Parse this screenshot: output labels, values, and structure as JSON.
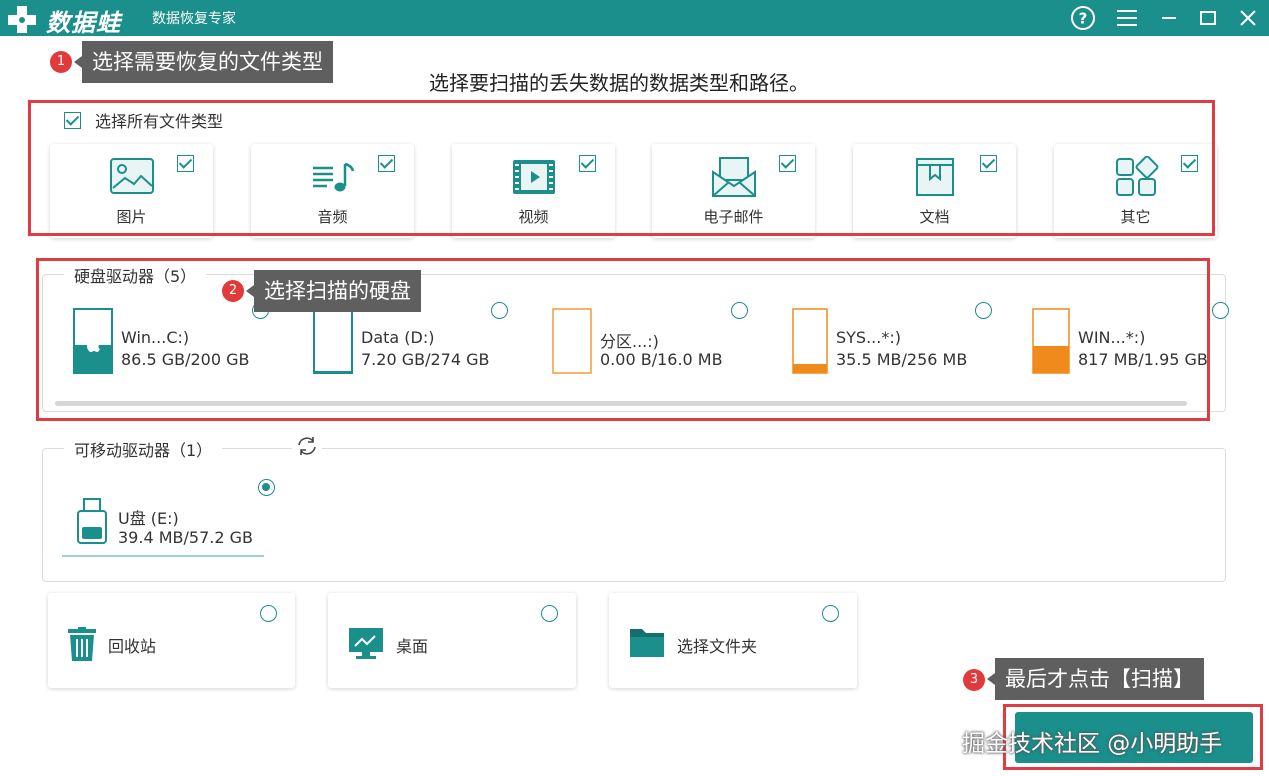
{
  "titlebar": {
    "app_name": "数据蛙",
    "subtitle": "数据恢复专家"
  },
  "annotations": {
    "step1_num": "1",
    "step1_text": "选择需要恢复的文件类型",
    "step2_num": "2",
    "step2_text": "选择扫描的硬盘",
    "step3_num": "3",
    "step3_text": "最后才点击【扫描】"
  },
  "heading": "选择要扫描的丢失数据的数据类型和路径。",
  "file_types": {
    "select_all_label": "选择所有文件类型",
    "items": [
      {
        "label": "图片",
        "icon": "image-icon"
      },
      {
        "label": "音频",
        "icon": "audio-icon"
      },
      {
        "label": "视频",
        "icon": "video-icon"
      },
      {
        "label": "电子邮件",
        "icon": "email-icon"
      },
      {
        "label": "文档",
        "icon": "document-icon"
      },
      {
        "label": "其它",
        "icon": "other-icon"
      }
    ]
  },
  "hard_drives": {
    "title": "硬盘驱动器（5）",
    "items": [
      {
        "name": "Win...C:)",
        "size": "86.5 GB/200 GB",
        "used_fraction": 0.43,
        "color": "#1a8f8c"
      },
      {
        "name": "Data (D:)",
        "size": "7.20 GB/274 GB",
        "used_fraction": 0.03,
        "color": "#1a8f8c"
      },
      {
        "name": "分区...:)",
        "size": "0.00  B/16.0 MB",
        "used_fraction": 0.0,
        "color": "#f29b38"
      },
      {
        "name": "SYS...*:)",
        "size": "35.5 MB/256 MB",
        "used_fraction": 0.14,
        "color": "#f08a1c"
      },
      {
        "name": "WIN...*:)",
        "size": "817 MB/1.95 GB",
        "used_fraction": 0.41,
        "color": "#f08a1c"
      }
    ]
  },
  "removable": {
    "title": "可移动驱动器（1）",
    "items": [
      {
        "name": "U盘 (E:)",
        "size": "39.4 MB/57.2 GB",
        "selected": true
      }
    ]
  },
  "locations": [
    {
      "label": "回收站",
      "icon": "recycle-bin-icon"
    },
    {
      "label": "桌面",
      "icon": "desktop-icon"
    },
    {
      "label": "选择文件夹",
      "icon": "folder-icon"
    }
  ],
  "watermark": "掘金技术社区 @小明助手",
  "colors": {
    "accent": "#1a8f8c",
    "annotation_red": "#e03c44",
    "callout_bg": "#5f5f5f"
  }
}
